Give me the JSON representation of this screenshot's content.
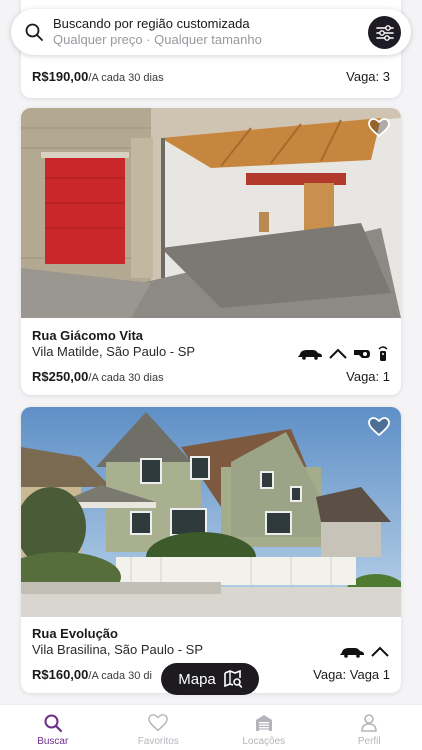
{
  "search": {
    "title": "Buscando por região customizada",
    "subtitle": "Qualquer preço · Qualquer tamanho"
  },
  "listings": [
    {
      "price": "R$190,00",
      "period": "/A cada 30 dias",
      "spots": "Vaga: 3"
    },
    {
      "street": "Rua Giácomo Vita",
      "location": "Vila Matilde, São Paulo - SP",
      "price": "R$250,00",
      "period": "/A cada 30 dias",
      "spots": "Vaga: 1",
      "amenities": [
        "car-icon",
        "covered-icon",
        "security-camera-icon",
        "remote-control-icon"
      ],
      "favorite": false
    },
    {
      "street": "Rua Evolução",
      "location": "Vila Brasilina, São Paulo - SP",
      "price": "R$160,00",
      "period": "/A cada 30 di",
      "spots": "Vaga: Vaga 1",
      "amenities": [
        "car-icon",
        "covered-icon"
      ],
      "favorite": false
    }
  ],
  "map_button": {
    "label": "Mapa"
  },
  "nav": [
    {
      "label": "Buscar",
      "icon": "search-icon",
      "active": true
    },
    {
      "label": "Favoritos",
      "icon": "heart-icon",
      "active": false
    },
    {
      "label": "Locações",
      "icon": "garage-icon",
      "active": false
    },
    {
      "label": "Perfil",
      "icon": "person-icon",
      "active": false
    }
  ],
  "colors": {
    "accent": "#6b2f8a",
    "dark": "#1d1b1f",
    "inactive": "#b6b4ba"
  }
}
